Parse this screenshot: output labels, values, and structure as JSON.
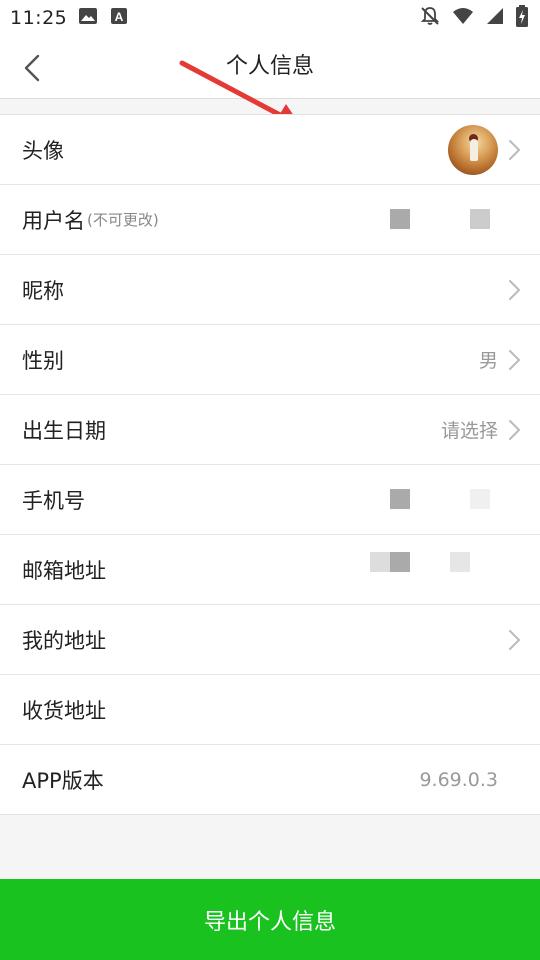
{
  "status_bar": {
    "time": "11:25",
    "left_icons": [
      "image-icon",
      "a-notification-icon"
    ],
    "right_icons": [
      "bell-off-icon",
      "wifi-icon",
      "signal-icon",
      "battery-charging-icon"
    ]
  },
  "header": {
    "title": "个人信息",
    "back_icon": "chevron-left-icon"
  },
  "rows": {
    "avatar": {
      "label": "头像"
    },
    "username": {
      "label": "用户名",
      "note": "(不可更改)"
    },
    "nickname": {
      "label": "昵称"
    },
    "gender": {
      "label": "性别",
      "value": "男"
    },
    "birthday": {
      "label": "出生日期",
      "value": "请选择"
    },
    "phone": {
      "label": "手机号"
    },
    "email": {
      "label": "邮箱地址"
    },
    "my_address": {
      "label": "我的地址"
    },
    "shipping_address": {
      "label": "收货地址"
    },
    "app_version": {
      "label": "APP版本",
      "value": "9.69.0.3"
    }
  },
  "export_button": {
    "label": "导出个人信息"
  },
  "colors": {
    "accent": "#1ac21f",
    "annotation": "#e53935"
  }
}
